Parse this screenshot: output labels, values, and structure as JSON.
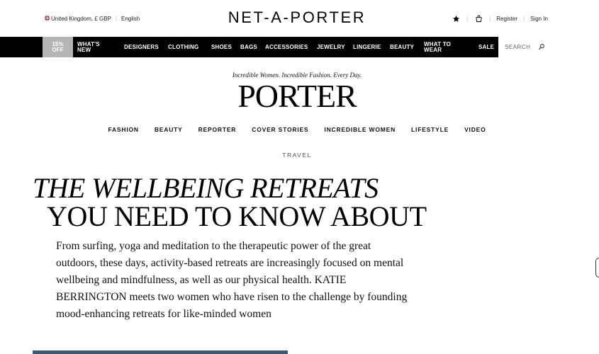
{
  "topbar": {
    "locale": "United Kingdom, £ GBP",
    "language": "English",
    "logo": "NET-A-PORTER",
    "wishlist_icon": "star-icon",
    "bag_icon": "shopping-bag-icon",
    "register": "Register",
    "sign_in": "Sign In"
  },
  "nav": {
    "promo_line1": "15%",
    "promo_line2": "OFF",
    "whats_new_1": "WHAT'S",
    "whats_new_2": "NEW",
    "designers": "DESIGNERS",
    "clothing": "CLOTHING",
    "shoes": "SHOES",
    "bags": "BAGS",
    "accessories": "ACCESSORIES",
    "jewelry": "JEWELRY",
    "lingerie": "LINGERIE",
    "beauty": "BEAUTY",
    "what_to_wear_1": "WHAT TO",
    "what_to_wear_2": "WEAR",
    "sale": "SALE",
    "search_placeholder": "SEARCH",
    "search_icon": "search-icon"
  },
  "porter": {
    "tagline": "Incredible Women. Incredible Fashion. Every Day.",
    "logo": "PORTER",
    "sections": [
      "FASHION",
      "BEAUTY",
      "REPORTER",
      "COVER STORIES",
      "INCREDIBLE WOMEN",
      "LIFESTYLE",
      "VIDEO"
    ]
  },
  "article": {
    "category": "TRAVEL",
    "headline_line1": "THE WELLBEING RETREATS",
    "headline_line2": "YOU NEED TO KNOW ABOUT",
    "standfirst": "From surfing, yoga and meditation to the therapeutic power of the great outdoors, these days, activity-based retreats are increasingly focused on mental wellbeing and mindfulness, as well as our physical health. KATIE BERRINGTON meets two women who have risen to the challenge by founding mood-enhancing retreats for like-minded women"
  },
  "colors": {
    "nav_bg": "#000000",
    "promo_bg": "#b5b5b5",
    "hero_strip": "#3f5a6e"
  }
}
